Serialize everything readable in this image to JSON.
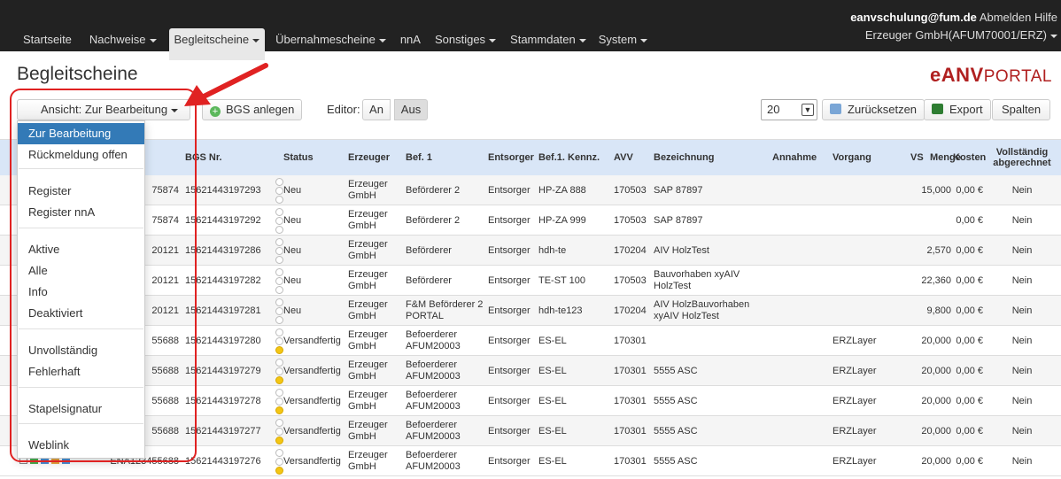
{
  "nav": {
    "items": [
      {
        "label": "Startseite",
        "caret": false
      },
      {
        "label": "Nachweise",
        "caret": true
      },
      {
        "label": "Begleitscheine",
        "caret": true,
        "active": true
      },
      {
        "label": "Übernahmescheine",
        "caret": true
      },
      {
        "label": "nnA",
        "caret": false
      },
      {
        "label": "Sonstiges",
        "caret": true
      },
      {
        "label": "Stammdaten",
        "caret": true
      },
      {
        "label": "System",
        "caret": true
      }
    ],
    "user_email": "eanvschulung@fum.de",
    "logout": "Abmelden",
    "help": "Hilfe",
    "account": "Erzeuger GmbH(AFUM70001/ERZ)"
  },
  "page": {
    "title": "Begleitscheine",
    "logo_main": "eANV",
    "logo_sub": "PORTAL"
  },
  "toolbar": {
    "view_label": "Ansicht: Zur Bearbeitung",
    "create_label": "BGS anlegen",
    "editor_label": "Editor:",
    "editor_on": "An",
    "editor_off": "Aus",
    "page_size": "20",
    "reset_label": "Zurücksetzen",
    "export_label": "Export",
    "columns_label": "Spalten"
  },
  "dropdown": {
    "items": [
      "Zur Bearbeitung",
      "Rückmeldung offen",
      "Register",
      "Register nnA",
      "Aktive",
      "Alle",
      "Info",
      "Deaktiviert",
      "Unvollständig",
      "Fehlerhaft",
      "Stapelsignatur",
      "Weblink"
    ],
    "active": "Zur Bearbeitung"
  },
  "table": {
    "headers": [
      "Nr.",
      "BGS Nr.",
      "Status",
      "Erzeuger",
      "Bef. 1",
      "Entsorger",
      "Bef.1. Kennz.",
      "AVV",
      "Bezeichnung",
      "Annahme",
      "Vorgang",
      "VS",
      "Menge",
      "Kosten",
      "Vollständig abgerechnet"
    ],
    "rows": [
      {
        "nr": "75874",
        "bgs": "15621443197293",
        "status": "Neu",
        "erzeuger": "Erzeuger GmbH",
        "bef1": "Beförderer 2",
        "entsorger": "Entsorger",
        "kennz": "HP-ZA 888",
        "avv": "170503",
        "bez": "SAP 87897",
        "annahme": "",
        "vorgang": "",
        "vs": "",
        "menge": "15,000",
        "kosten": "0,00 €",
        "voll": "Nein"
      },
      {
        "nr": "75874",
        "bgs": "15621443197292",
        "status": "Neu",
        "erzeuger": "Erzeuger GmbH",
        "bef1": "Beförderer 2",
        "entsorger": "Entsorger",
        "kennz": "HP-ZA 999",
        "avv": "170503",
        "bez": "SAP 87897",
        "annahme": "",
        "vorgang": "",
        "vs": "",
        "menge": "",
        "kosten": "0,00 €",
        "voll": "Nein"
      },
      {
        "nr": "20121",
        "bgs": "15621443197286",
        "status": "Neu",
        "erzeuger": "Erzeuger GmbH",
        "bef1": "Beförderer",
        "entsorger": "Entsorger",
        "kennz": "hdh-te",
        "avv": "170204",
        "bez": "AIV HolzTest",
        "annahme": "",
        "vorgang": "",
        "vs": "",
        "menge": "2,570",
        "kosten": "0,00 €",
        "voll": "Nein"
      },
      {
        "nr": "20121",
        "bgs": "15621443197282",
        "status": "Neu",
        "erzeuger": "Erzeuger GmbH",
        "bef1": "Beförderer",
        "entsorger": "Entsorger",
        "kennz": "TE-ST 100",
        "avv": "170503",
        "bez": "Bauvorhaben xyAIV HolzTest",
        "annahme": "",
        "vorgang": "",
        "vs": "",
        "menge": "22,360",
        "kosten": "0,00 €",
        "voll": "Nein"
      },
      {
        "nr": "20121",
        "bgs": "15621443197281",
        "status": "Neu",
        "erzeuger": "Erzeuger GmbH",
        "bef1": "F&M Beförderer 2 PORTAL",
        "entsorger": "Entsorger",
        "kennz": "hdh-te123",
        "avv": "170204",
        "bez": "AIV HolzBauvorhaben xyAIV HolzTest",
        "annahme": "",
        "vorgang": "",
        "vs": "",
        "menge": "9,800",
        "kosten": "0,00 €",
        "voll": "Nein"
      },
      {
        "nr": "55688",
        "bgs": "15621443197280",
        "status": "Versandfertig",
        "erzeuger": "Erzeuger GmbH",
        "bef1": "Befoerderer AFUM20003",
        "entsorger": "Entsorger",
        "kennz": "ES-EL",
        "avv": "170301",
        "bez": "",
        "annahme": "",
        "vorgang": "ERZLayer",
        "vs": "",
        "menge": "20,000",
        "kosten": "0,00 €",
        "voll": "Nein"
      },
      {
        "nr": "55688",
        "bgs": "15621443197279",
        "status": "Versandfertig",
        "erzeuger": "Erzeuger GmbH",
        "bef1": "Befoerderer AFUM20003",
        "entsorger": "Entsorger",
        "kennz": "ES-EL",
        "avv": "170301",
        "bez": "5555 ASC",
        "annahme": "",
        "vorgang": "ERZLayer",
        "vs": "",
        "menge": "20,000",
        "kosten": "0,00 €",
        "voll": "Nein"
      },
      {
        "nr": "55688",
        "bgs": "15621443197278",
        "status": "Versandfertig",
        "erzeuger": "Erzeuger GmbH",
        "bef1": "Befoerderer AFUM20003",
        "entsorger": "Entsorger",
        "kennz": "ES-EL",
        "avv": "170301",
        "bez": "5555 ASC",
        "annahme": "",
        "vorgang": "ERZLayer",
        "vs": "",
        "menge": "20,000",
        "kosten": "0,00 €",
        "voll": "Nein"
      },
      {
        "nr": "55688",
        "bgs": "15621443197277",
        "status": "Versandfertig",
        "erzeuger": "Erzeuger GmbH",
        "bef1": "Befoerderer AFUM20003",
        "entsorger": "Entsorger",
        "kennz": "ES-EL",
        "avv": "170301",
        "bez": "5555 ASC",
        "annahme": "",
        "vorgang": "ERZLayer",
        "vs": "",
        "menge": "20,000",
        "kosten": "0,00 €",
        "voll": "Nein"
      },
      {
        "nr": "ENA123455688",
        "bgs": "15621443197276",
        "status": "Versandfertig",
        "erzeuger": "Erzeuger GmbH",
        "bef1": "Befoerderer AFUM20003",
        "entsorger": "Entsorger",
        "kennz": "ES-EL",
        "avv": "170301",
        "bez": "5555 ASC",
        "annahme": "",
        "vorgang": "ERZLayer",
        "vs": "",
        "menge": "20,000",
        "kosten": "0,00 €",
        "voll": "Nein"
      }
    ]
  },
  "colors": {
    "navbar": "#222222",
    "active_item": "#337ab7",
    "table_header": "#d9e6f7",
    "highlight": "#e02222",
    "logo": "#b02020",
    "status_ready": "#f3c614"
  }
}
